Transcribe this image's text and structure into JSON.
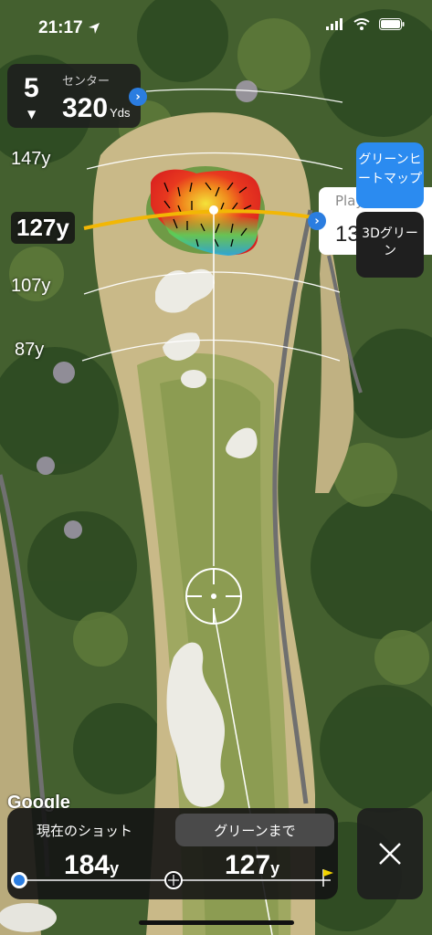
{
  "status_bar": {
    "time": "21:17",
    "icons": [
      "location-arrow-icon",
      "signal-icon",
      "wifi-icon",
      "battery-icon"
    ]
  },
  "hole": {
    "number": "5",
    "target_label": "センター",
    "distance": "320",
    "unit": "Yds"
  },
  "distance_arcs": [
    {
      "label": "147y"
    },
    {
      "label": "127y"
    },
    {
      "label": "107y"
    },
    {
      "label": "87y"
    }
  ],
  "buttons": {
    "green_heatmap": "グリーンヒートマップ",
    "green_3d": "3Dグリーン"
  },
  "plays_like": {
    "title": "Plays Like",
    "value": "13"
  },
  "map": {
    "attribution": "Google"
  },
  "bottom_panel": {
    "tab_current": "現在のショット",
    "tab_to_green": "グリーンまで",
    "current_shot_value": "184",
    "to_green_value": "127",
    "unit": "y"
  },
  "colors": {
    "accent_blue": "#2b7de0",
    "arc_highlight": "#f2b705",
    "panel_dark": "#1f1f1f"
  }
}
